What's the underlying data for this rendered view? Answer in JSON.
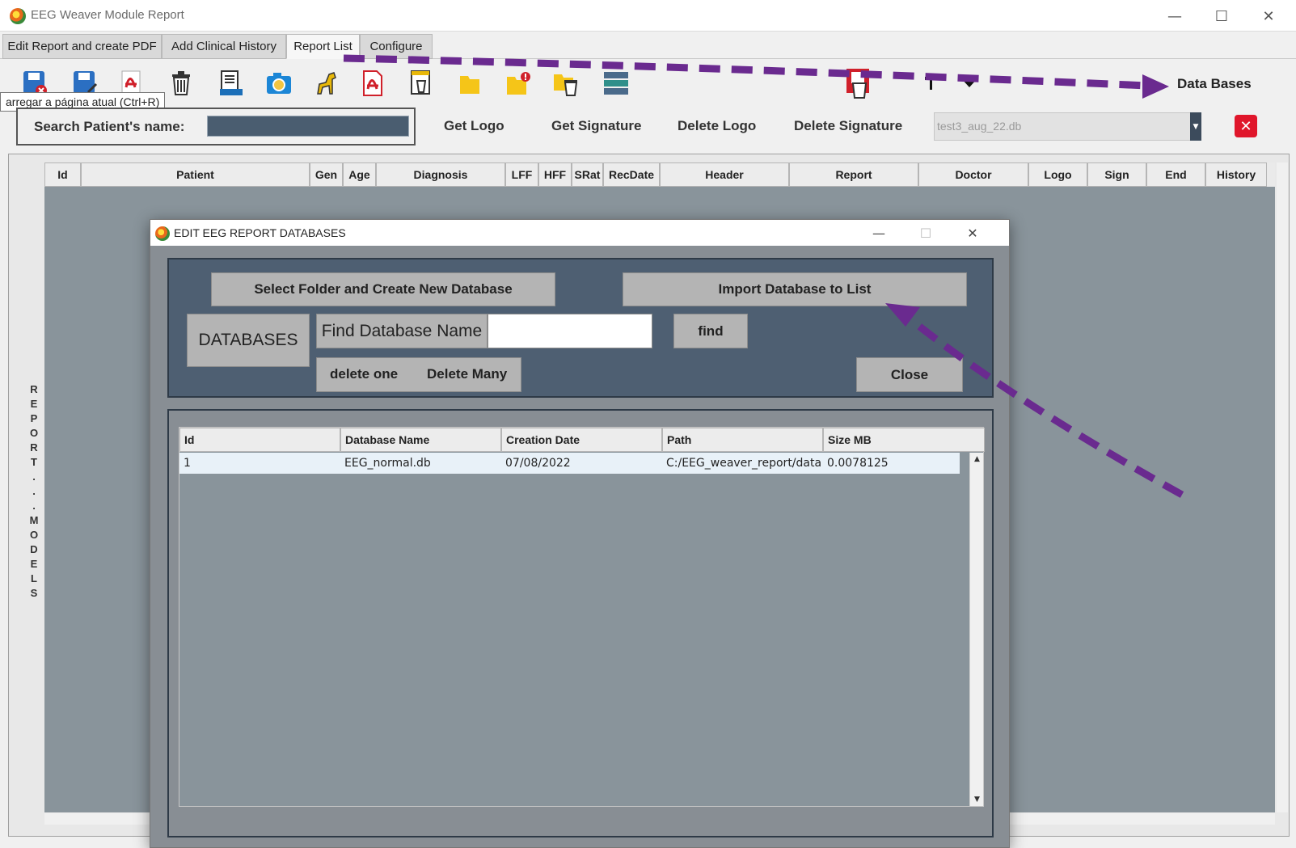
{
  "window": {
    "title": "EEG Weaver Module Report",
    "minimize": "—",
    "maximize": "☐",
    "close": "✕"
  },
  "tabs": [
    {
      "label": "Edit Report and create PDF"
    },
    {
      "label": "Add Clinical History"
    },
    {
      "label": "Report List"
    },
    {
      "label": "Configure"
    }
  ],
  "tooltip": "arregar a página atual (Ctrl+R)",
  "search": {
    "label": "Search Patient's name:"
  },
  "actions": {
    "get_logo": "Get Logo",
    "get_signature": "Get Signature",
    "delete_logo": "Delete Logo",
    "delete_signature": "Delete Signature"
  },
  "database_select": {
    "value": "test3_aug_22.db",
    "arrow": "▼"
  },
  "databases_link": "Data Bases",
  "clear_button": "✕",
  "side_label": "REPORT...MODELS",
  "report_columns": [
    "Id",
    "Patient",
    "Gen",
    "Age",
    "Diagnosis",
    "LFF",
    "HFF",
    "SRat",
    "RecDate",
    "Header",
    "Report",
    "Doctor",
    "Logo",
    "Sign",
    "End",
    "History"
  ],
  "dialog": {
    "title": "EDIT EEG REPORT DATABASES",
    "minimize": "—",
    "maximize": "☐",
    "close": "✕",
    "create_button": "Select Folder and Create New Database",
    "import_button": "Import Database to List",
    "databases_label": "DATABASES",
    "find_label": "Find Database Name",
    "find_value": "",
    "find_button": "find",
    "delete_one": "delete one",
    "delete_many": "Delete Many",
    "close_button": "Close",
    "table": {
      "columns": [
        "Id",
        "Database Name",
        "Creation Date",
        "Path",
        "Size MB"
      ],
      "rows": [
        [
          "1",
          "EEG_normal.db",
          "07/08/2022",
          "C:/EEG_weaver_report/data",
          "0.0078125"
        ]
      ]
    },
    "scroll_up": "▲",
    "scroll_down": "▼"
  },
  "colors": {
    "annotation_arrow": "#6a2a8f",
    "dialog_panel": "#4e5f72",
    "grid_background": "#89949b",
    "clear_button": "#e0162b"
  }
}
